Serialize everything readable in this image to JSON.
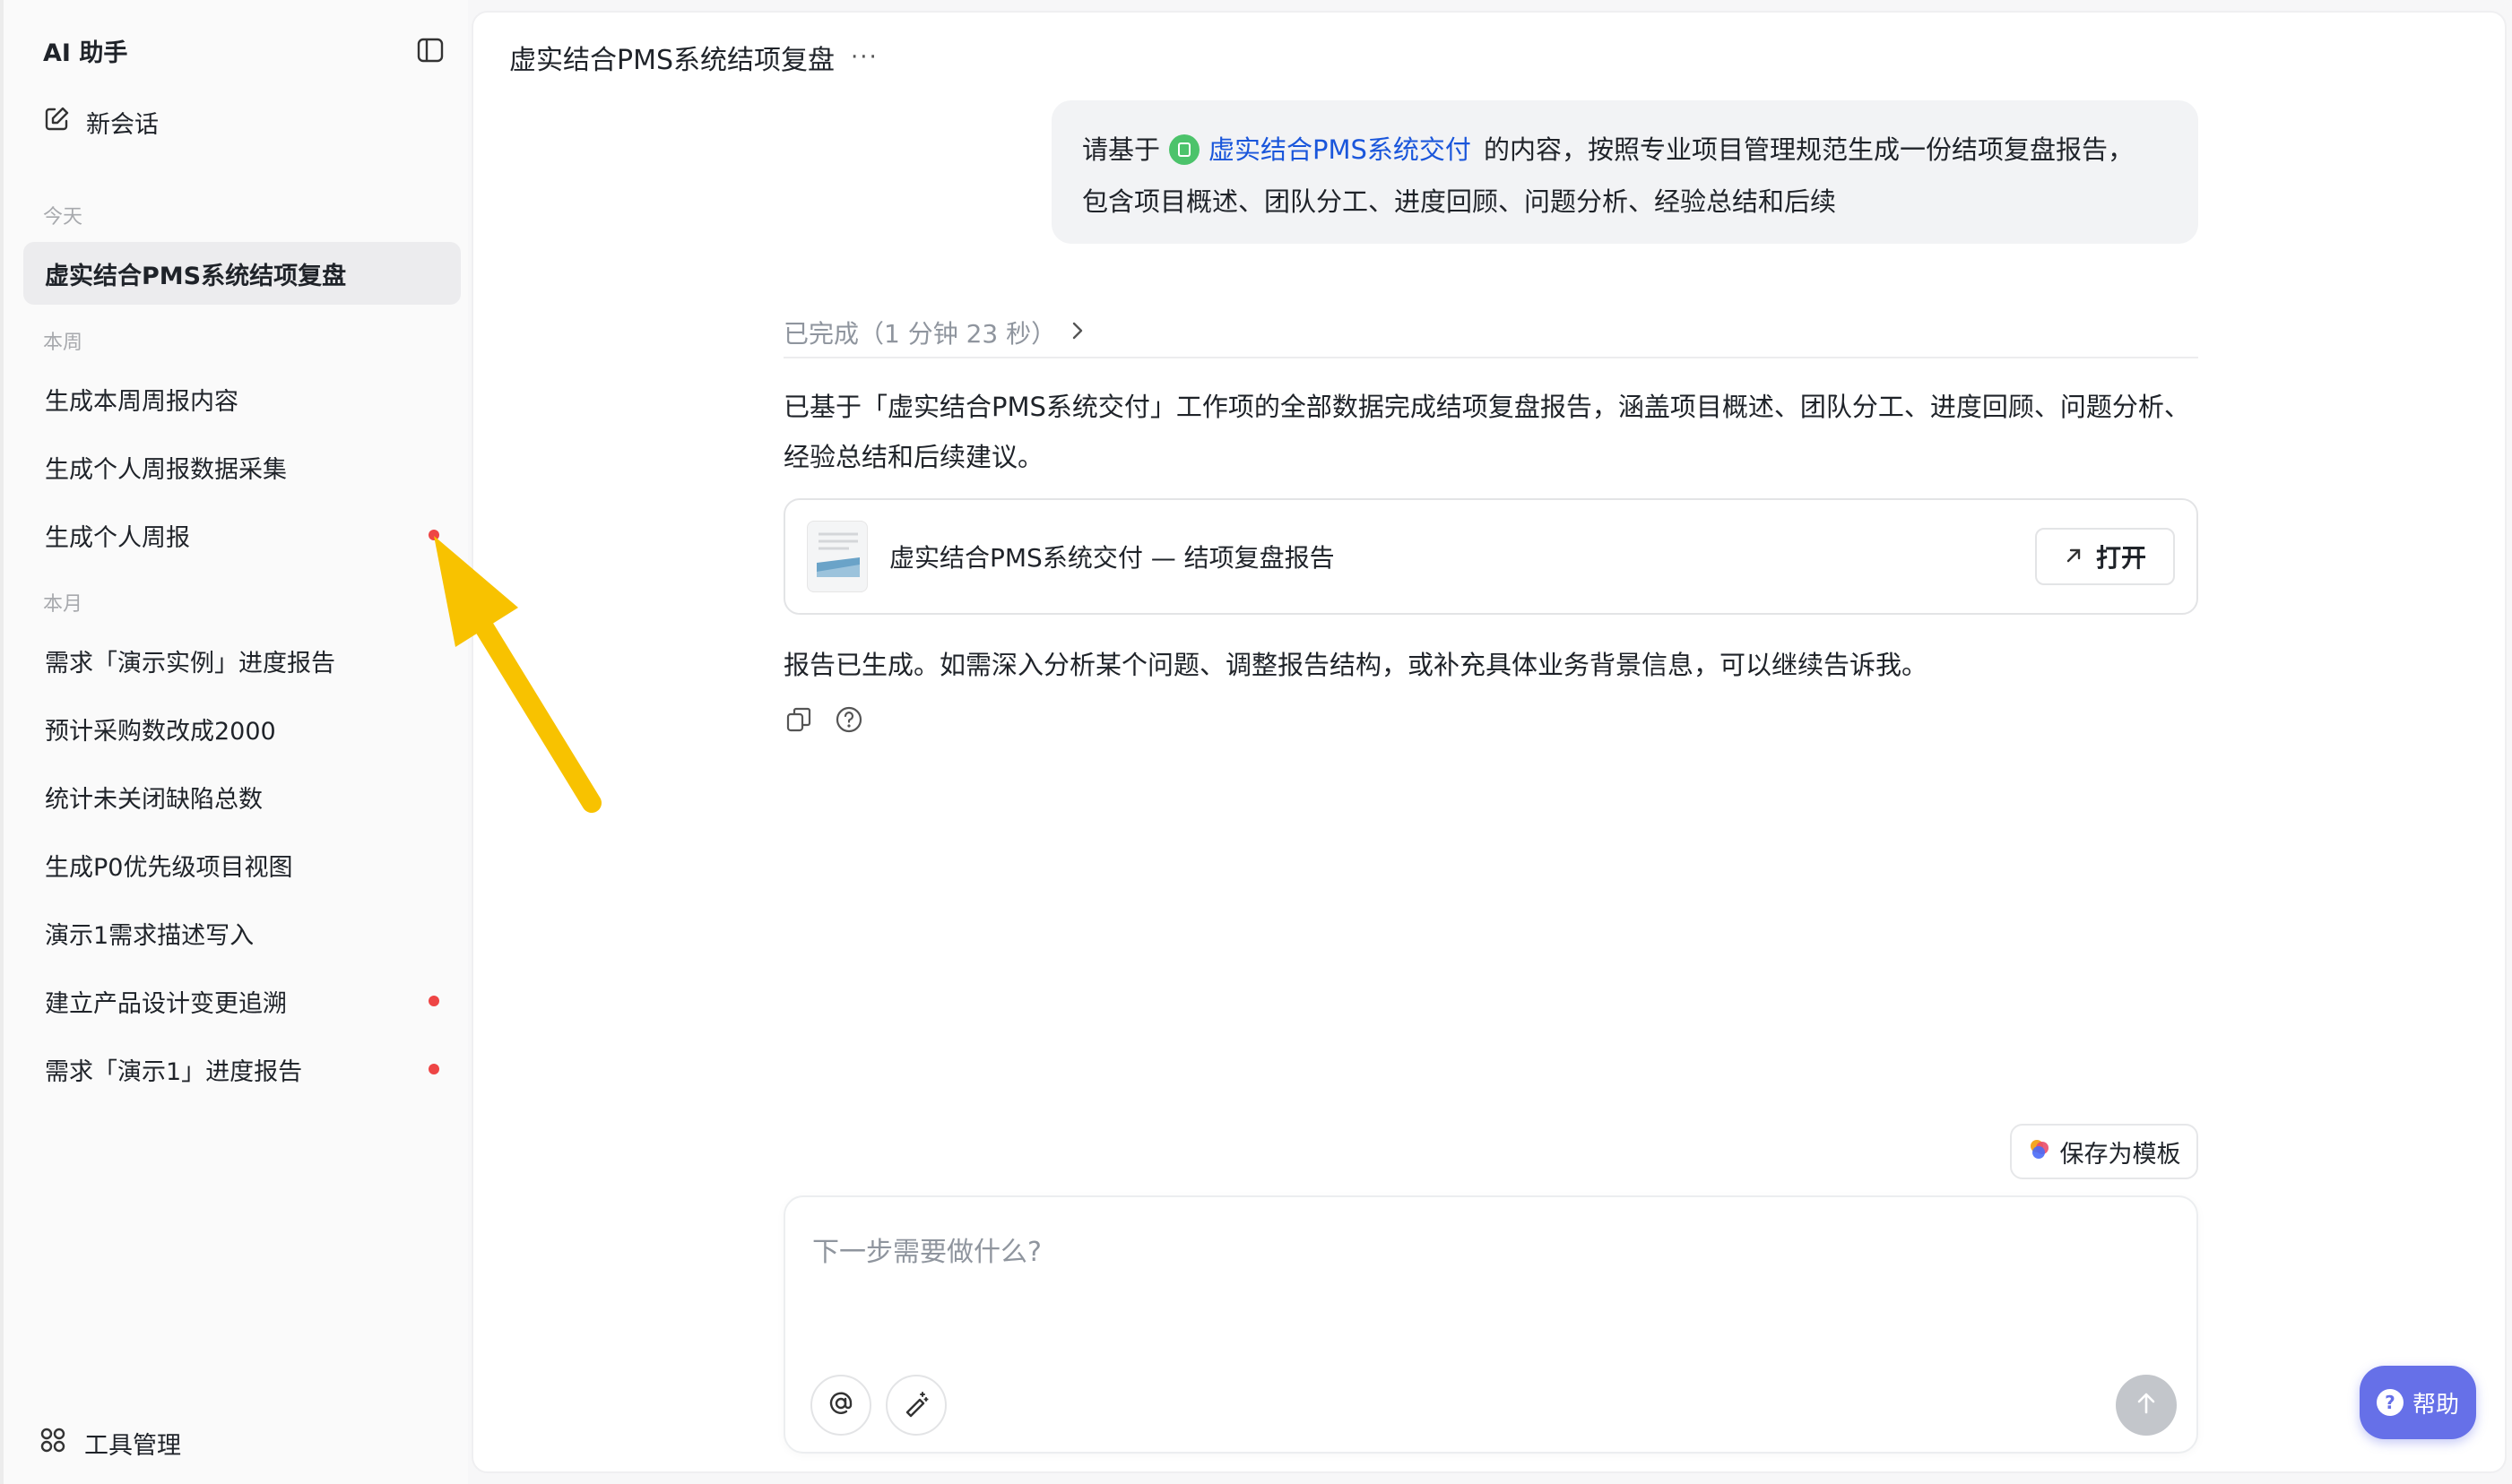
{
  "sidebar": {
    "title": "AI 助手",
    "new_chat": "新会话",
    "groups": {
      "today": "今天",
      "week": "本周",
      "month": "本月"
    },
    "items": [
      {
        "label": "虚实结合PMS系统结项复盘",
        "active": true,
        "unread": false
      },
      {
        "label": "生成本周周报内容",
        "active": false,
        "unread": false
      },
      {
        "label": "生成个人周报数据采集",
        "active": false,
        "unread": false
      },
      {
        "label": "生成个人周报",
        "active": false,
        "unread": true
      },
      {
        "label": "需求「演示实例」进度报告",
        "active": false,
        "unread": false
      },
      {
        "label": "预计采购数改成2000",
        "active": false,
        "unread": false
      },
      {
        "label": "统计未关闭缺陷总数",
        "active": false,
        "unread": false
      },
      {
        "label": "生成P0优先级项目视图",
        "active": false,
        "unread": false
      },
      {
        "label": "演示1需求描述写入",
        "active": false,
        "unread": false
      },
      {
        "label": "建立产品设计变更追溯",
        "active": false,
        "unread": true
      },
      {
        "label": "需求「演示1」进度报告",
        "active": false,
        "unread": true
      }
    ],
    "tools_label": "工具管理"
  },
  "conversation": {
    "title": "虚实结合PMS系统结项复盘",
    "more": "···",
    "user_message": {
      "prefix": "请基于",
      "reference": "虚实结合PMS系统交付",
      "suffix": "的内容，按照专业项目管理规范生成一份结项复盘报告，",
      "line2": "包含项目概述、团队分工、进度回顾、问题分析、经验总结和后续"
    },
    "status": "已完成（1 分钟 23 秒）",
    "answer": "已基于「虚实结合PMS系统交付」工作项的全部数据完成结项复盘报告，涵盖项目概述、团队分工、进度回顾、问题分析、经验总结和后续建议。",
    "doc_card": {
      "title": "虚实结合PMS系统交付 — 结项复盘报告",
      "open_label": "打开"
    },
    "answer2": "报告已生成。如需深入分析某个问题、调整报告结构，或补充具体业务背景信息，可以继续告诉我。"
  },
  "save_template": "保存为模板",
  "composer": {
    "placeholder": "下一步需要做什么?"
  },
  "help": "帮助",
  "colors": {
    "accent": "#6670e8",
    "link": "#1a56db",
    "unread_dot": "#ee4545",
    "annotation_arrow": "#f8c200"
  }
}
